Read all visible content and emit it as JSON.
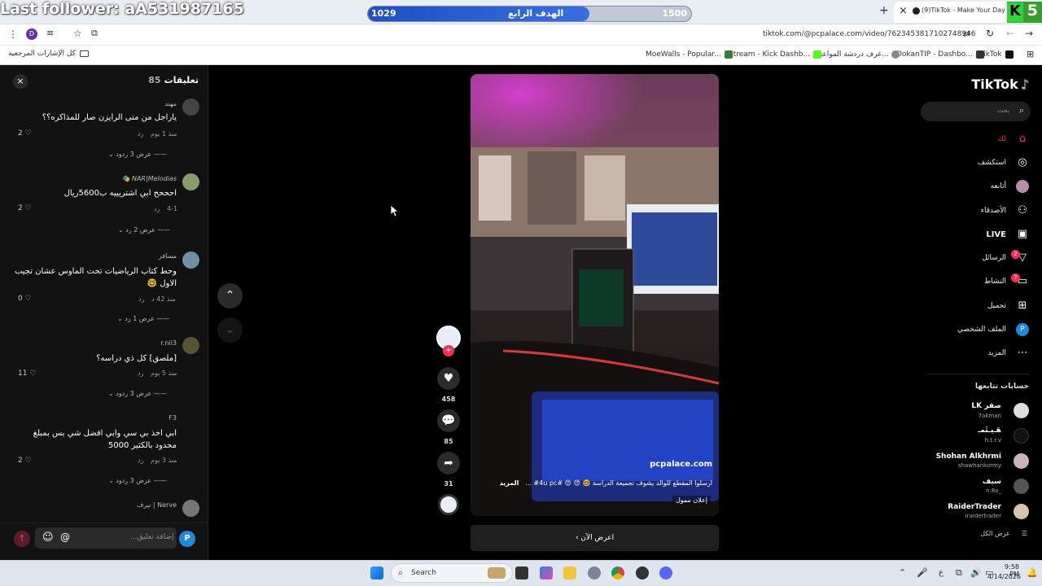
{
  "overlay": {
    "follower_text": "Last follower: aA531987165",
    "goal_current": "1029",
    "goal_label": "الهدف الرابع",
    "goal_target": "1500",
    "goal_progress": 0.686,
    "corner_letter": "K",
    "corner_number": "5"
  },
  "browser": {
    "tab_title": "(9)TikTok - Make Your Day",
    "tab_close": "×",
    "new_tab": "+",
    "url": "tiktok.com/@pcpalace.com/video/7623453817102748946",
    "bookmarks": [
      {
        "label": "TikTok",
        "color": "#111"
      },
      {
        "label": "DokanTIP - Dashbo...",
        "color": "#333"
      },
      {
        "label": "غرف دردشة المواعدة...",
        "color": "#888"
      },
      {
        "label": "Stream - Kick Dashb...",
        "color": "#53fc18"
      },
      {
        "label": "MoeWalls - Popular...",
        "color": "#3a7a3a"
      }
    ],
    "all_bookmarks": "كل الإشارات المرجعية",
    "profile_letter": "D"
  },
  "comments": {
    "title": "تعليقات",
    "count": "85",
    "close": "×",
    "items": [
      {
        "name": "مهند",
        "text": "ياراجل من متى الرايزن صار للمذاكره؟؟",
        "time": "منذ 1 يوم",
        "reply": "رد",
        "likes": "2",
        "replies": "عرض 3 ردود"
      },
      {
        "name": "🎭 NAR|Melodias",
        "text": "احححح ابي اشتريييه ب5600ريال",
        "time": "4-1",
        "reply": "رد",
        "likes": "2",
        "replies": "عرض 2 رد"
      },
      {
        "name": "مسافر",
        "text": "وحط كتاب الرياضيات تحت الماوس عشان تجيب",
        "text2": "الاول 🤓",
        "time": "منذ 42 د",
        "reply": "رد",
        "likes": "0",
        "replies": "عرض 1 رد"
      },
      {
        "name": "r.nil3",
        "text": "[ملصق] كل ذي دراسه؟",
        "time": "منذ 5 يوم",
        "reply": "رد",
        "likes": "11",
        "replies": "عرض 3 ردود"
      },
      {
        "name": "F3",
        "text": "ابي اخذ بي سي وابي افضل شي بس بمبلغ",
        "text2": "محدود بالكثير 5000",
        "time": "منذ 3 يوم",
        "reply": "رد",
        "likes": "2",
        "replies": "عرض 3 ردود"
      },
      {
        "name": "نيرف | Nerve",
        "text": "",
        "time": "",
        "reply": "",
        "likes": "",
        "replies": ""
      }
    ],
    "input_placeholder": "إضافة تعليق...",
    "at": "@"
  },
  "video": {
    "caption": "ارسلوا المقطع للوالد يشوف تجميعة الدراسة 🤓 😍 😍 #4u pc# ...",
    "more": "المزيد",
    "sponsored": "إعلان ممول",
    "watermark": "pcpalace.com",
    "cta": "اعرض الآن",
    "likes": "458",
    "comments": "85",
    "shares": "31"
  },
  "sidebar": {
    "logo": "TikTok",
    "search_placeholder": "بحث",
    "nav": [
      {
        "label": "لك",
        "icon": "⌂",
        "active": true
      },
      {
        "label": "استكشف",
        "icon": "◎"
      },
      {
        "label": "أتابعه",
        "icon": "●"
      },
      {
        "label": "الأصدقاء",
        "icon": "⚇"
      },
      {
        "label": "LIVE",
        "icon": "▣"
      },
      {
        "label": "الرسائل",
        "icon": "▽",
        "badge": "2"
      },
      {
        "label": "النشاط",
        "icon": "▭",
        "badge": "7"
      },
      {
        "label": "تحميل",
        "icon": "⊞"
      },
      {
        "label": "الملف الشخصي",
        "icon": "P"
      },
      {
        "label": "المزيد",
        "icon": "⋯"
      }
    ],
    "following_title": "حسابات تتابعها",
    "following": [
      {
        "name": "LK صقر",
        "user": "7okman"
      },
      {
        "name": "هَـيـثَمـ",
        "user": "h.t.r.v"
      },
      {
        "name": "Shohan Alkhrmi",
        "user": "shawhankormy"
      },
      {
        "name": "سيف",
        "user": "n.8o_"
      },
      {
        "name": "RaiderTrader",
        "user": "iraidertrader"
      }
    ],
    "see_all": "عرض الكل"
  },
  "taskbar": {
    "search": "Search",
    "time": "9:58 PM",
    "date": "4/14/2026",
    "lang": "ع"
  }
}
